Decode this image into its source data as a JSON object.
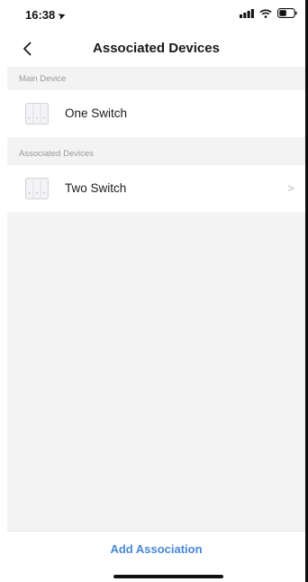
{
  "status_bar": {
    "time": "16:38",
    "icons": [
      "location-icon",
      "signal-icon",
      "wifi-icon",
      "battery-icon"
    ]
  },
  "nav": {
    "back_glyph": "<",
    "title": "Associated Devices"
  },
  "sections": {
    "main_device": {
      "header": "Main Device",
      "device_label": "One Switch",
      "device_icon": "switch-panel-icon"
    },
    "associated_devices": {
      "header": "Associated Devices",
      "device_label": "Two Switch",
      "device_icon": "switch-panel-icon",
      "chevron": ">"
    }
  },
  "bottom": {
    "add_association_label": "Add Association"
  },
  "colors": {
    "accent": "#4a86d6",
    "background": "#f3f3f4",
    "row_background": "#ffffff",
    "section_text": "#9a9a9e"
  }
}
